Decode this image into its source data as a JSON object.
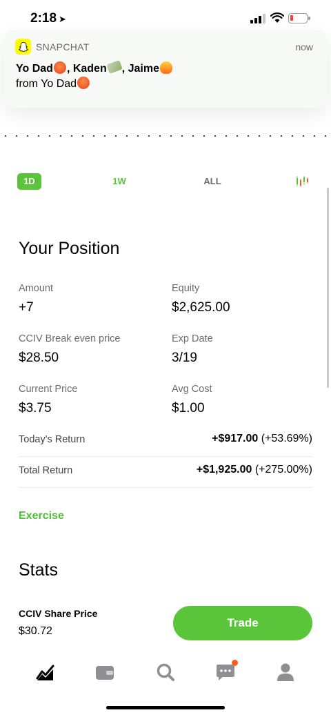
{
  "status_bar": {
    "time": "2:18",
    "location_icon": "location-arrow-icon",
    "battery_color": "#ff3b30"
  },
  "notification": {
    "app_name": "SNAPCHAT",
    "time": "now",
    "title_parts": [
      "Yo Dad",
      ", Kaden",
      ", Jaime"
    ],
    "body": "from Yo Dad",
    "app_icon": "snapchat-ghost-icon"
  },
  "range_tabs": [
    "1D",
    "1W",
    "ALL"
  ],
  "range_selected": "1D",
  "position": {
    "title": "Your Position",
    "fields": [
      {
        "label": "Amount",
        "value": "+7"
      },
      {
        "label": "Equity",
        "value": "$2,625.00"
      },
      {
        "label": "CCIV Break even price",
        "value": "$28.50"
      },
      {
        "label": "Exp Date",
        "value": "3/19"
      },
      {
        "label": "Current Price",
        "value": "$3.75"
      },
      {
        "label": "Avg Cost",
        "value": "$1.00"
      }
    ],
    "todays_return": {
      "label": "Today's Return",
      "amount": "+$917.00",
      "percent": "(+53.69%)"
    },
    "total_return": {
      "label": "Total Return",
      "amount": "+$1,925.00",
      "percent": "(+275.00%)"
    }
  },
  "exercise_label": "Exercise",
  "stats_title": "Stats",
  "trade_bar": {
    "share_label": "CCIV Share Price",
    "share_price": "$30.72",
    "trade_button": "Trade"
  },
  "tab_bar": {
    "items": [
      "chart-icon",
      "wallet-icon",
      "search-icon",
      "messages-icon",
      "account-icon"
    ],
    "selected": "chart-icon"
  },
  "colors": {
    "accent": "#5ac53b",
    "text_secondary": "#6b6b6b",
    "notification_dot": "#ff5a1f"
  }
}
